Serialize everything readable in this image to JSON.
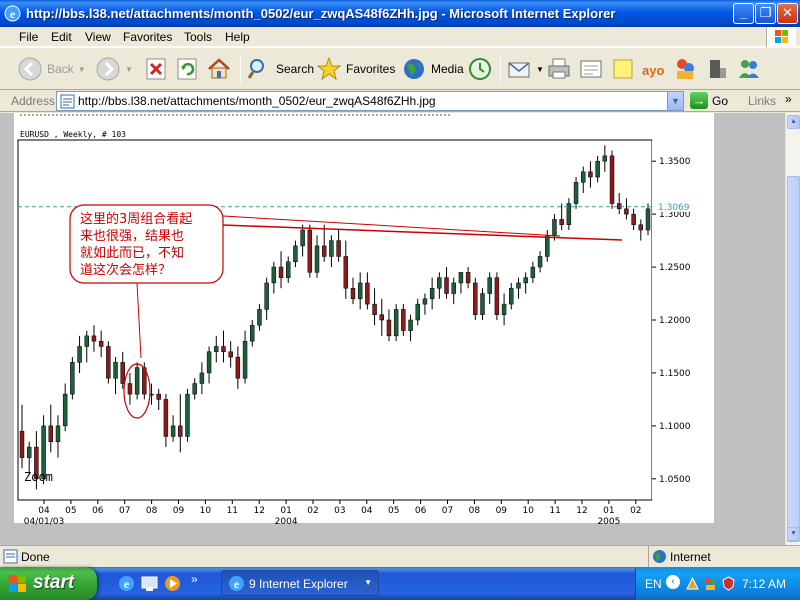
{
  "window": {
    "title": "http://bbs.l38.net/attachments/month_0502/eur_zwqAS48f6ZHh.jpg - Microsoft Internet Explorer",
    "minimize": "_",
    "maximize": "❐",
    "close": "✕"
  },
  "menu": [
    "File",
    "Edit",
    "View",
    "Favorites",
    "Tools",
    "Help"
  ],
  "toolbar": {
    "back": "Back",
    "search": "Search",
    "favorites": "Favorites",
    "media": "Media"
  },
  "address": {
    "label": "Address",
    "url": "http://bbs.l38.net/attachments/month_0502/eur_zwqAS48f6ZHh.jpg",
    "go": "Go",
    "links": "Links",
    "links_chevron": "»"
  },
  "status": {
    "text": "Done",
    "zone": "Internet"
  },
  "taskbar": {
    "start": "start",
    "task": "9 Internet Explorer",
    "lang": "EN",
    "clock": "7:12 AM"
  },
  "chart_data": {
    "type": "candlestick",
    "header": "EURUSD , Weekly, # 103",
    "watermark": "Zoom",
    "annotation": "这里的3周组合看起来也很强，结果也就如此而已，不知道这次会怎样？",
    "annotation_lines": [
      "这里的3周组合看起",
      "来也很强，结果也",
      "就如此而已，不知",
      "道这次会怎样？"
    ],
    "current_price": "1.3069",
    "y_ticks": [
      "1.3500",
      "1.3000",
      "1.2500",
      "1.2000",
      "1.1500",
      "1.1000",
      "1.0500"
    ],
    "ylim": [
      1.03,
      1.37
    ],
    "x_ticks": [
      "04",
      "05",
      "06",
      "07",
      "08",
      "09",
      "10",
      "11",
      "12",
      "01",
      "02",
      "03",
      "04",
      "05",
      "06",
      "07",
      "08",
      "09",
      "10",
      "11",
      "12",
      "01",
      "02"
    ],
    "x_sublabels": [
      {
        "text": "04/01/03",
        "tick_index": 0
      },
      {
        "text": "2004",
        "tick_index": 9
      },
      {
        "text": "2005",
        "tick_index": 21
      }
    ],
    "candles": [
      [
        1.095,
        1.12,
        1.06,
        1.07
      ],
      [
        1.07,
        1.085,
        1.055,
        1.08
      ],
      [
        1.08,
        1.095,
        1.04,
        1.05
      ],
      [
        1.05,
        1.11,
        1.045,
        1.1
      ],
      [
        1.1,
        1.12,
        1.075,
        1.085
      ],
      [
        1.085,
        1.11,
        1.07,
        1.1
      ],
      [
        1.1,
        1.14,
        1.095,
        1.13
      ],
      [
        1.13,
        1.165,
        1.125,
        1.16
      ],
      [
        1.16,
        1.185,
        1.15,
        1.175
      ],
      [
        1.175,
        1.19,
        1.16,
        1.185
      ],
      [
        1.185,
        1.195,
        1.17,
        1.18
      ],
      [
        1.18,
        1.19,
        1.165,
        1.175
      ],
      [
        1.175,
        1.18,
        1.14,
        1.145
      ],
      [
        1.145,
        1.165,
        1.13,
        1.16
      ],
      [
        1.16,
        1.17,
        1.135,
        1.14
      ],
      [
        1.14,
        1.15,
        1.12,
        1.13
      ],
      [
        1.13,
        1.16,
        1.125,
        1.155
      ],
      [
        1.155,
        1.16,
        1.125,
        1.13
      ],
      [
        1.13,
        1.14,
        1.12,
        1.13
      ],
      [
        1.13,
        1.135,
        1.115,
        1.125
      ],
      [
        1.125,
        1.13,
        1.08,
        1.09
      ],
      [
        1.09,
        1.11,
        1.085,
        1.1
      ],
      [
        1.1,
        1.13,
        1.075,
        1.09
      ],
      [
        1.09,
        1.135,
        1.085,
        1.13
      ],
      [
        1.13,
        1.145,
        1.125,
        1.14
      ],
      [
        1.14,
        1.16,
        1.13,
        1.15
      ],
      [
        1.15,
        1.175,
        1.14,
        1.17
      ],
      [
        1.17,
        1.185,
        1.16,
        1.175
      ],
      [
        1.175,
        1.19,
        1.16,
        1.17
      ],
      [
        1.17,
        1.18,
        1.155,
        1.165
      ],
      [
        1.165,
        1.175,
        1.135,
        1.145
      ],
      [
        1.145,
        1.19,
        1.14,
        1.18
      ],
      [
        1.18,
        1.2,
        1.175,
        1.195
      ],
      [
        1.195,
        1.215,
        1.19,
        1.21
      ],
      [
        1.21,
        1.24,
        1.2,
        1.235
      ],
      [
        1.235,
        1.255,
        1.225,
        1.25
      ],
      [
        1.25,
        1.265,
        1.23,
        1.24
      ],
      [
        1.24,
        1.26,
        1.235,
        1.255
      ],
      [
        1.255,
        1.275,
        1.25,
        1.27
      ],
      [
        1.27,
        1.29,
        1.26,
        1.285
      ],
      [
        1.285,
        1.29,
        1.24,
        1.245
      ],
      [
        1.245,
        1.28,
        1.24,
        1.27
      ],
      [
        1.27,
        1.29,
        1.255,
        1.26
      ],
      [
        1.26,
        1.28,
        1.25,
        1.275
      ],
      [
        1.275,
        1.285,
        1.255,
        1.26
      ],
      [
        1.26,
        1.275,
        1.22,
        1.23
      ],
      [
        1.23,
        1.24,
        1.215,
        1.22
      ],
      [
        1.22,
        1.245,
        1.21,
        1.235
      ],
      [
        1.235,
        1.245,
        1.21,
        1.215
      ],
      [
        1.215,
        1.23,
        1.195,
        1.205
      ],
      [
        1.205,
        1.22,
        1.185,
        1.2
      ],
      [
        1.2,
        1.21,
        1.18,
        1.185
      ],
      [
        1.185,
        1.215,
        1.18,
        1.21
      ],
      [
        1.21,
        1.215,
        1.185,
        1.19
      ],
      [
        1.19,
        1.205,
        1.18,
        1.2
      ],
      [
        1.2,
        1.22,
        1.195,
        1.215
      ],
      [
        1.215,
        1.225,
        1.205,
        1.22
      ],
      [
        1.22,
        1.24,
        1.21,
        1.23
      ],
      [
        1.23,
        1.245,
        1.22,
        1.24
      ],
      [
        1.24,
        1.25,
        1.22,
        1.225
      ],
      [
        1.225,
        1.24,
        1.215,
        1.235
      ],
      [
        1.235,
        1.245,
        1.225,
        1.245
      ],
      [
        1.245,
        1.25,
        1.23,
        1.235
      ],
      [
        1.235,
        1.24,
        1.2,
        1.205
      ],
      [
        1.205,
        1.23,
        1.2,
        1.225
      ],
      [
        1.225,
        1.245,
        1.215,
        1.24
      ],
      [
        1.24,
        1.245,
        1.2,
        1.205
      ],
      [
        1.205,
        1.225,
        1.195,
        1.215
      ],
      [
        1.215,
        1.235,
        1.21,
        1.23
      ],
      [
        1.23,
        1.24,
        1.22,
        1.235
      ],
      [
        1.235,
        1.245,
        1.225,
        1.24
      ],
      [
        1.24,
        1.255,
        1.235,
        1.25
      ],
      [
        1.25,
        1.265,
        1.245,
        1.26
      ],
      [
        1.26,
        1.285,
        1.255,
        1.28
      ],
      [
        1.28,
        1.3,
        1.275,
        1.295
      ],
      [
        1.295,
        1.31,
        1.285,
        1.29
      ],
      [
        1.29,
        1.315,
        1.285,
        1.31
      ],
      [
        1.31,
        1.335,
        1.305,
        1.33
      ],
      [
        1.33,
        1.345,
        1.32,
        1.34
      ],
      [
        1.34,
        1.35,
        1.325,
        1.335
      ],
      [
        1.335,
        1.355,
        1.33,
        1.35
      ],
      [
        1.35,
        1.365,
        1.34,
        1.355
      ],
      [
        1.355,
        1.36,
        1.305,
        1.31
      ],
      [
        1.31,
        1.32,
        1.3,
        1.305
      ],
      [
        1.305,
        1.315,
        1.295,
        1.3
      ],
      [
        1.3,
        1.305,
        1.285,
        1.29
      ],
      [
        1.29,
        1.295,
        1.275,
        1.285
      ],
      [
        1.285,
        1.31,
        1.28,
        1.305
      ]
    ],
    "colors": {
      "up": "#1E5E3A",
      "down": "#8B1A1A",
      "annotation": "#CC0000",
      "level_line": "#3A9CA6"
    }
  }
}
